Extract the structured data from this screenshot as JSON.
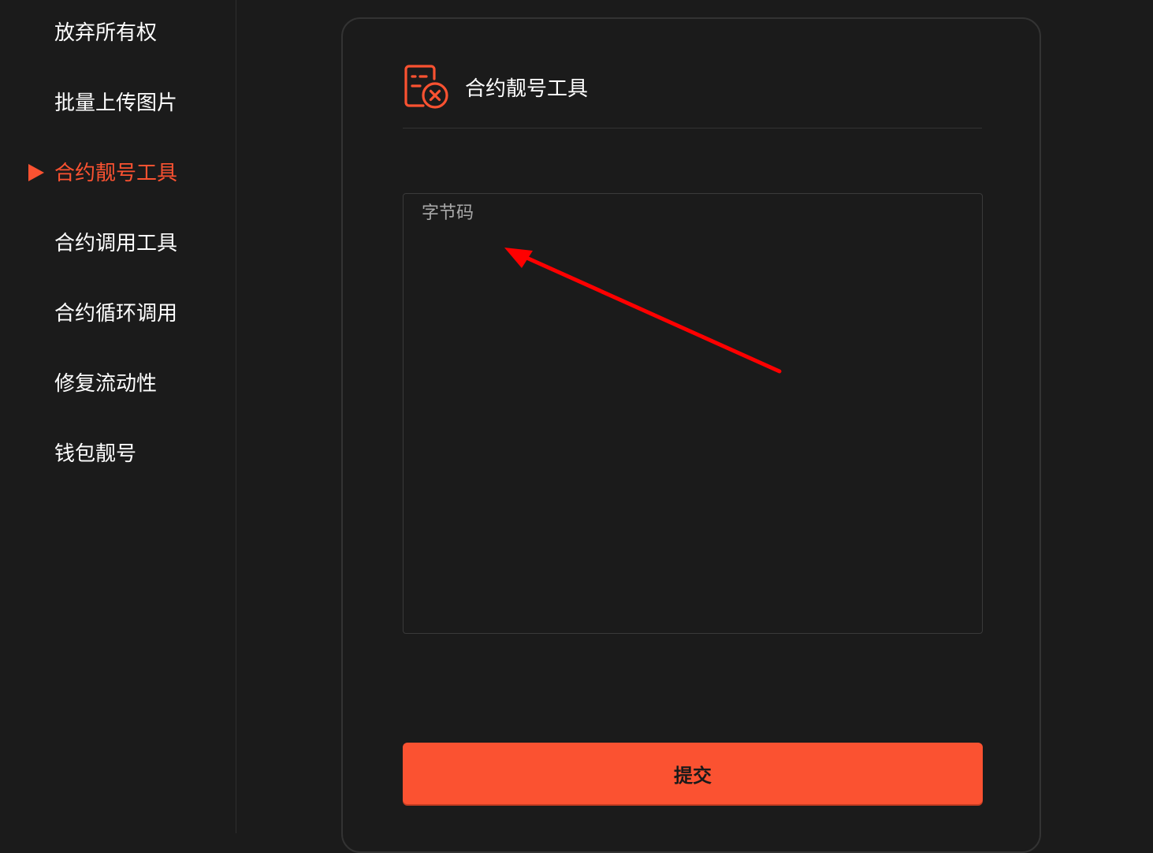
{
  "sidebar": {
    "items": [
      {
        "label": "放弃所有权",
        "active": false
      },
      {
        "label": "批量上传图片",
        "active": false
      },
      {
        "label": "合约靓号工具",
        "active": true
      },
      {
        "label": "合约调用工具",
        "active": false
      },
      {
        "label": "合约循环调用",
        "active": false
      },
      {
        "label": "修复流动性",
        "active": false
      },
      {
        "label": "钱包靓号",
        "active": false
      }
    ]
  },
  "card": {
    "title": "合约靓号工具",
    "icon": "contract-cancel-icon",
    "bytecode_placeholder": "字节码",
    "bytecode_value": "",
    "submit_label": "提交"
  },
  "colors": {
    "accent": "#fb5231",
    "background": "#1b1b1b",
    "text": "#ffffff",
    "annotation": "#ff0000"
  }
}
